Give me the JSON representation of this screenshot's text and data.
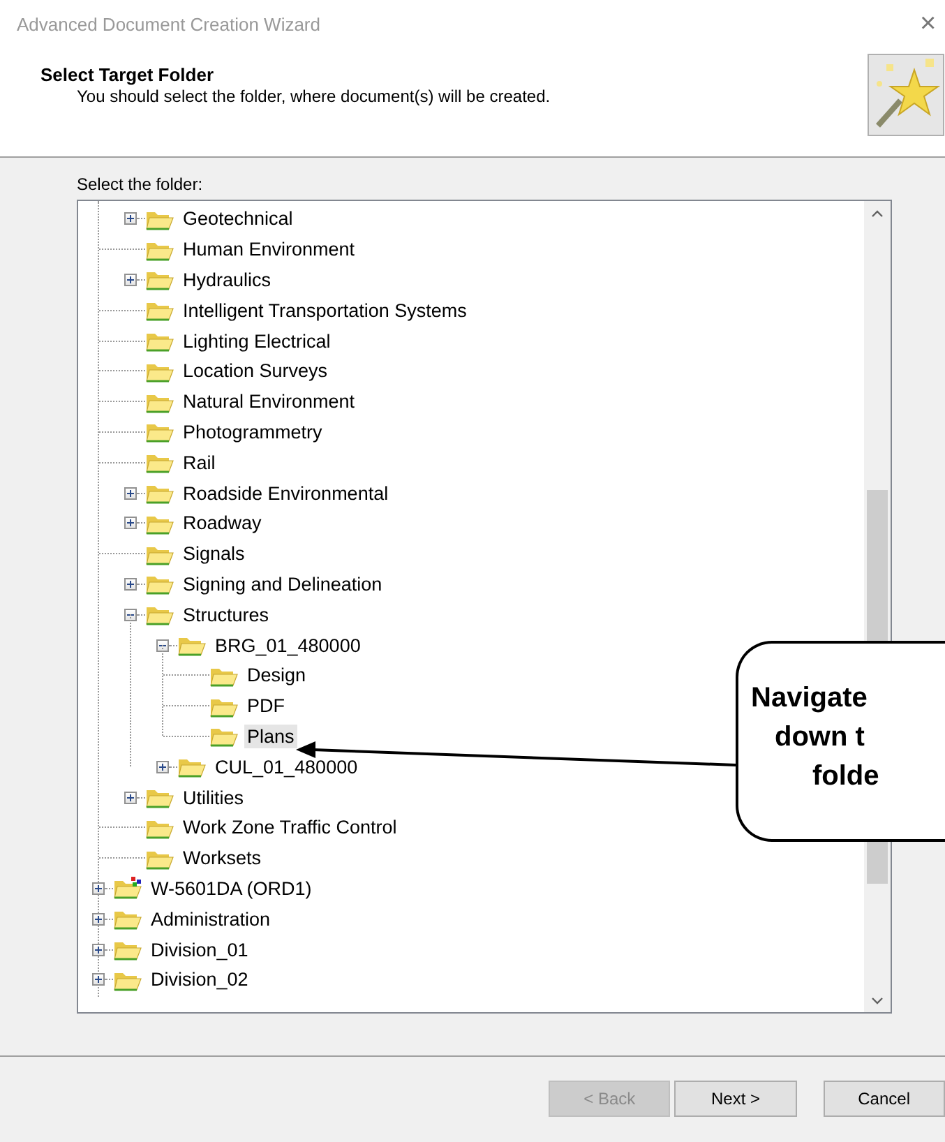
{
  "window": {
    "title": "Advanced Document Creation Wizard",
    "close": "×"
  },
  "header": {
    "title": "Select Target Folder",
    "subtitle": "You should select the folder, where document(s) will be created."
  },
  "tree_label": "Select the folder:",
  "tree": {
    "continued_children": [
      {
        "label": "Geotechnical",
        "kind": "folder",
        "expanded": false,
        "selected": false
      },
      {
        "label": "Human Environment",
        "kind": "folder",
        "selected": false
      },
      {
        "label": "Hydraulics",
        "kind": "folder",
        "expanded": false,
        "selected": false
      },
      {
        "label": "Intelligent Transportation Systems",
        "kind": "folder",
        "selected": false
      },
      {
        "label": "Lighting Electrical",
        "kind": "folder",
        "selected": false
      },
      {
        "label": "Location Surveys",
        "kind": "folder",
        "selected": false
      },
      {
        "label": "Natural Environment",
        "kind": "folder",
        "selected": false
      },
      {
        "label": "Photogrammetry",
        "kind": "folder",
        "selected": false
      },
      {
        "label": "Rail",
        "kind": "folder",
        "selected": false
      },
      {
        "label": "Roadside Environmental",
        "kind": "folder",
        "expanded": false,
        "selected": false
      },
      {
        "label": "Roadway",
        "kind": "folder",
        "expanded": false,
        "selected": false
      },
      {
        "label": "Signals",
        "kind": "folder",
        "selected": false
      },
      {
        "label": "Signing and Delineation",
        "kind": "folder",
        "expanded": false,
        "selected": false
      },
      {
        "label": "Structures",
        "kind": "folder",
        "expanded": true,
        "selected": false,
        "children": [
          {
            "label": "BRG_01_480000",
            "kind": "folder",
            "expanded": true,
            "selected": false,
            "children": [
              {
                "label": "Design",
                "kind": "folder",
                "selected": false
              },
              {
                "label": "PDF",
                "kind": "folder",
                "selected": false
              },
              {
                "label": "Plans",
                "kind": "folder",
                "selected": true
              }
            ]
          },
          {
            "label": "CUL_01_480000",
            "kind": "folder",
            "expanded": false,
            "selected": false
          }
        ]
      },
      {
        "label": "Utilities",
        "kind": "folder",
        "expanded": false,
        "selected": false
      },
      {
        "label": "Work Zone Traffic Control",
        "kind": "folder",
        "selected": false
      },
      {
        "label": "Worksets",
        "kind": "folder",
        "selected": false
      }
    ],
    "items": [
      {
        "label": "W-5601DA (ORD1)",
        "kind": "project",
        "expanded": false,
        "selected": false
      },
      {
        "label": "Administration",
        "kind": "folder",
        "expanded": false,
        "selected": false
      },
      {
        "label": "Division_01",
        "kind": "folder",
        "expanded": false,
        "selected": false
      },
      {
        "label": "Division_02",
        "kind": "folder",
        "expanded": false,
        "selected": false
      }
    ]
  },
  "buttons": [
    {
      "label": "< Back",
      "disabled": true
    },
    {
      "label": "Next >",
      "disabled": false
    },
    {
      "label": "Cancel",
      "disabled": false
    }
  ],
  "callout": {
    "lines": [
      "Navigate",
      "down t",
      "folde"
    ]
  }
}
